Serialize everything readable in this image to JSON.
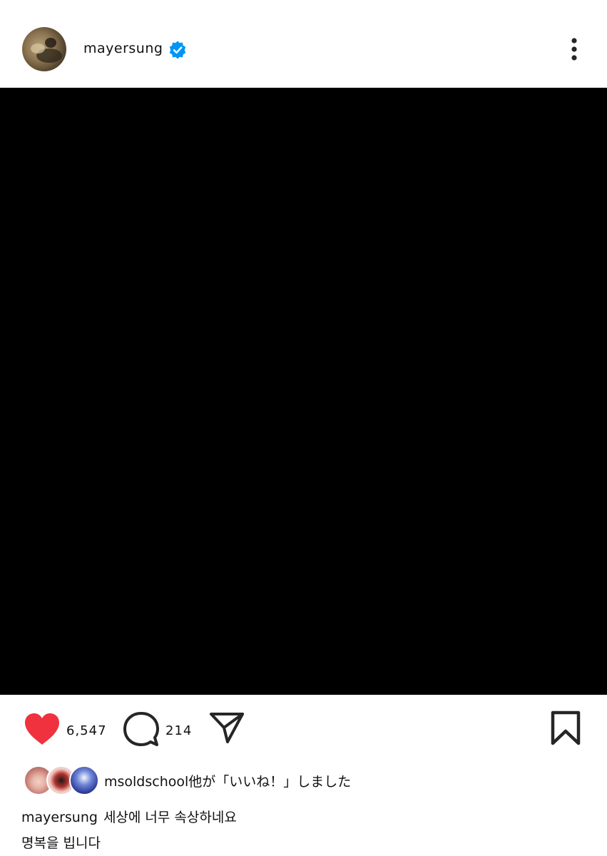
{
  "post": {
    "username": "mayersung",
    "likes_count": "6,547",
    "comments_count": "214",
    "liked_by_text": "msoldschool他が「いいね！」しました",
    "caption_username": "mayersung",
    "caption_line1": "세상에 너무 속상하네요",
    "caption_line2": "명복을 빕니다"
  },
  "colors": {
    "like_red": "#f0313e",
    "verified_blue": "#0095f6",
    "media_background": "#000000",
    "icon_stroke": "#262626"
  },
  "icons": {
    "verified": "verified-badge-icon",
    "more": "more-options-icon",
    "like": "heart-icon",
    "comment": "comment-bubble-icon",
    "share": "paper-plane-icon",
    "save": "bookmark-icon"
  }
}
